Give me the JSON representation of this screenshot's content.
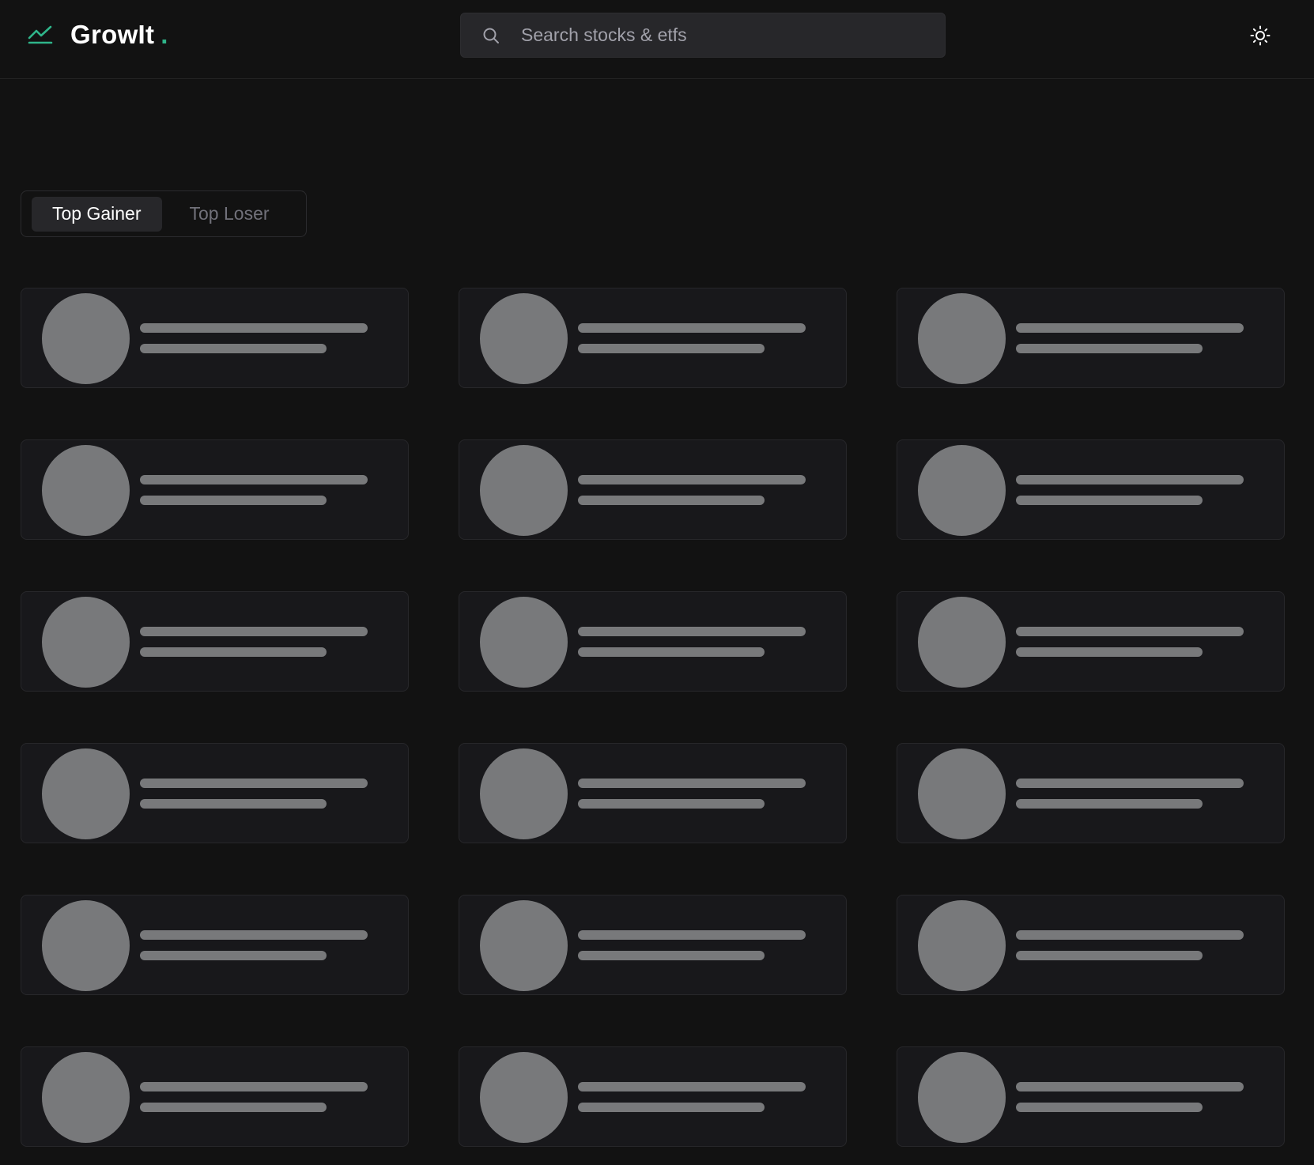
{
  "header": {
    "brand_name": "GrowIt",
    "brand_dot": ".",
    "brand_icon": "trending-up-icon",
    "theme_icon": "sun-icon",
    "search": {
      "placeholder": "Search stocks & etfs",
      "value": "",
      "icon": "search-icon"
    }
  },
  "tabs": {
    "active": "Top Gainer",
    "items": [
      {
        "label": "Top Gainer",
        "selected": true
      },
      {
        "label": "Top Loser",
        "selected": false
      }
    ]
  },
  "cards": {
    "state": "loading",
    "columns": 3,
    "rows": 6,
    "count": 18
  },
  "colors": {
    "background": "#121212",
    "accent": "#2fb58a",
    "card_background": "#18181b",
    "skeleton": "#78797b",
    "input_background": "#27272a",
    "inactive_text": "#71717a"
  }
}
